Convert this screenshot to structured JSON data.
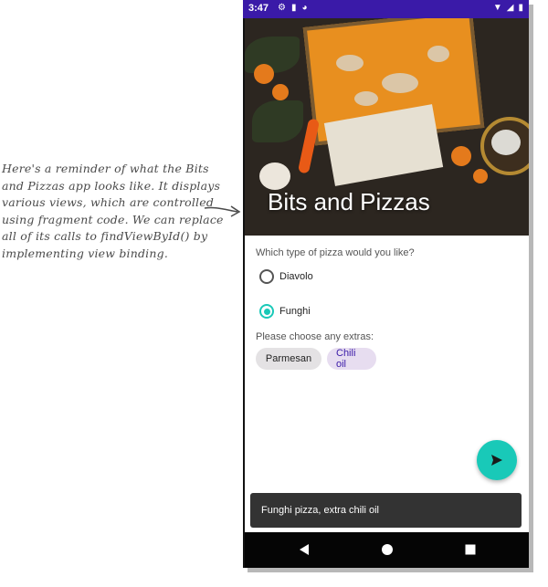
{
  "annotation": {
    "lines": [
      "Here's a reminder of what the Bits",
      "and Pizzas app looks like. It displays",
      "various views, which are controlled",
      "using fragment code. We can replace",
      "all of its calls to findViewById() by",
      "implementing view binding."
    ]
  },
  "status_bar": {
    "time": "3:47",
    "background": "#3a1aa8"
  },
  "app": {
    "title": "Bits and Pizzas",
    "pizza_question": "Which type of pizza would you like?",
    "pizza_options": [
      {
        "label": "Diavolo",
        "checked": false
      },
      {
        "label": "Funghi",
        "checked": true
      }
    ],
    "extras_question": "Please choose any extras:",
    "extras": [
      {
        "label": "Parmesan",
        "selected": false
      },
      {
        "label": "Chili oil",
        "selected": true
      }
    ],
    "fab_icon": "send-icon",
    "snackbar_text": "Funghi pizza, extra chili oil",
    "accent_color": "#19c9b8"
  },
  "nav": {
    "back_icon": "back-triangle-icon",
    "home_icon": "home-circle-icon",
    "recents_icon": "recents-square-icon"
  }
}
